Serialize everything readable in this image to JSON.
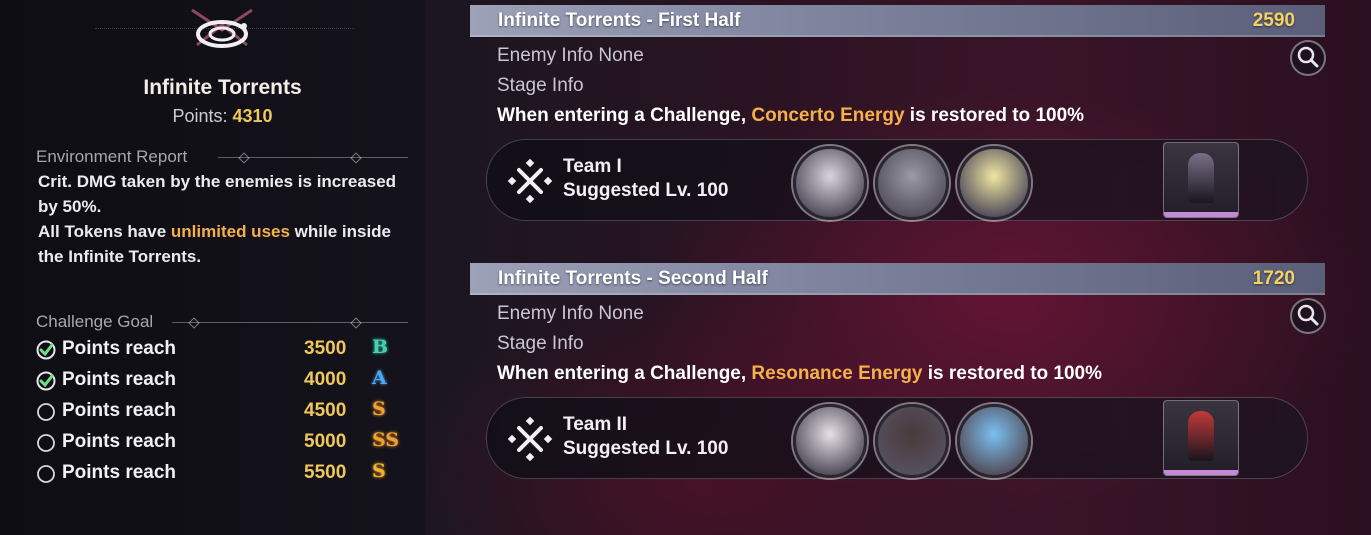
{
  "left": {
    "title": "Infinite Torrents",
    "points_label": "Points:",
    "points_value": "4310",
    "environment_heading": "Environment Report",
    "env_line1": "Crit. DMG taken by the enemies is increased by 50%.",
    "env_line2_pre": "All Tokens have ",
    "env_line2_hl": "unlimited uses",
    "env_line2_post": " while inside the Infinite Torrents.",
    "goal_heading": "Challenge Goal",
    "goals": [
      {
        "label": "Points reach",
        "value": "3500",
        "rank": "B",
        "rank_color": "#3fd3b0",
        "done": true
      },
      {
        "label": "Points reach",
        "value": "4000",
        "rank": "A",
        "rank_color": "#4aa8f0",
        "done": true
      },
      {
        "label": "Points reach",
        "value": "4500",
        "rank": "S",
        "rank_color": "#f0a030",
        "done": false
      },
      {
        "label": "Points reach",
        "value": "5000",
        "rank": "SS",
        "rank_color": "#f0a030",
        "done": false
      },
      {
        "label": "Points reach",
        "value": "5500",
        "rank": "S",
        "rank_color": "#f5b030",
        "done": false
      }
    ]
  },
  "stages": [
    {
      "name": "Infinite Torrents - First Half",
      "score": "2590",
      "enemy_label": "Enemy Info",
      "enemy_value": "None",
      "stage_label": "Stage Info",
      "desc_pre": "When entering a Challenge, ",
      "desc_hl": "Concerto Energy",
      "desc_post": " is restored to 100%",
      "team": "Team I",
      "level": "Suggested Lv. 100"
    },
    {
      "name": "Infinite Torrents - Second Half",
      "score": "1720",
      "enemy_label": "Enemy Info",
      "enemy_value": "None",
      "stage_label": "Stage Info",
      "desc_pre": "When entering a Challenge, ",
      "desc_hl": "Resonance Energy",
      "desc_post": " is restored to 100%",
      "team": "Team II",
      "level": "Suggested Lv. 100"
    }
  ],
  "icons": {
    "check": "check-circle-icon",
    "empty": "empty-circle-icon",
    "search": "magnifier-icon",
    "team": "crossed-swords-icon"
  },
  "colors": {
    "gold": "#f0c75a",
    "highlight": "#f5b04a",
    "stage_bar": "#8a8fa8"
  }
}
